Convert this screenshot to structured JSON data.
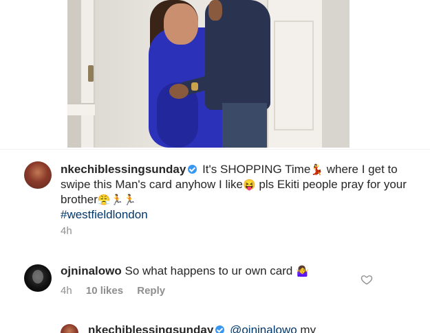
{
  "post": {
    "image_alt": "couple photo"
  },
  "comments": [
    {
      "username": "nkechiblessingsunday",
      "verified": true,
      "text_parts": [
        "It's SHOPPING Time",
        "💃",
        " where I get to swipe this Man's card anyhow I like",
        "😝",
        " pls Ekiti people pray for your brother",
        "😤🏃🏃"
      ],
      "hashtag": "#westfieldlondon",
      "time": "4h"
    },
    {
      "username": "ojninalowo",
      "text": "So what happens to ur own card",
      "emoji": "🤷‍♀️",
      "time": "4h",
      "likes": "10 likes",
      "reply": "Reply"
    },
    {
      "username": "nkechiblessingsunday",
      "verified": true,
      "mention": "@ojninalowo",
      "text": "my"
    }
  ],
  "icons": {
    "like": "heart-icon",
    "verified": "verified-badge-icon"
  },
  "colors": {
    "verified": "#3897f0",
    "link": "#00376b",
    "meta": "#8e8e8e"
  }
}
